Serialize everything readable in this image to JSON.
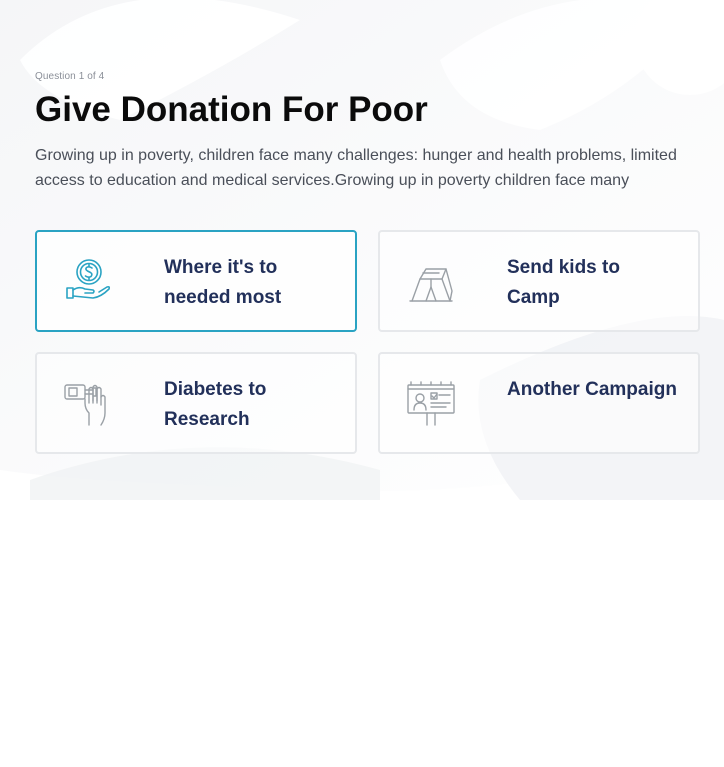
{
  "quiz": {
    "progress": "Question 1 of 4",
    "title": "Give Donation For Poor",
    "description": "Growing up in poverty, children face many challenges: hunger and health problems, limited access to education and medical services.Growing up in poverty children face many"
  },
  "options": [
    {
      "label": "Where it's to needed most",
      "icon": "coin-hand-icon",
      "selected": true
    },
    {
      "label": "Send kids to Camp",
      "icon": "tent-icon",
      "selected": false
    },
    {
      "label": "Diabetes to Research",
      "icon": "hand-glucose-meter-icon",
      "selected": false
    },
    {
      "label": "Another Campaign",
      "icon": "billboard-icon",
      "selected": false
    }
  ],
  "colors": {
    "accent": "#2aa3c3",
    "card_label": "#22305a",
    "title": "#0b0b0b",
    "icon_gray": "#9aa0a6"
  }
}
